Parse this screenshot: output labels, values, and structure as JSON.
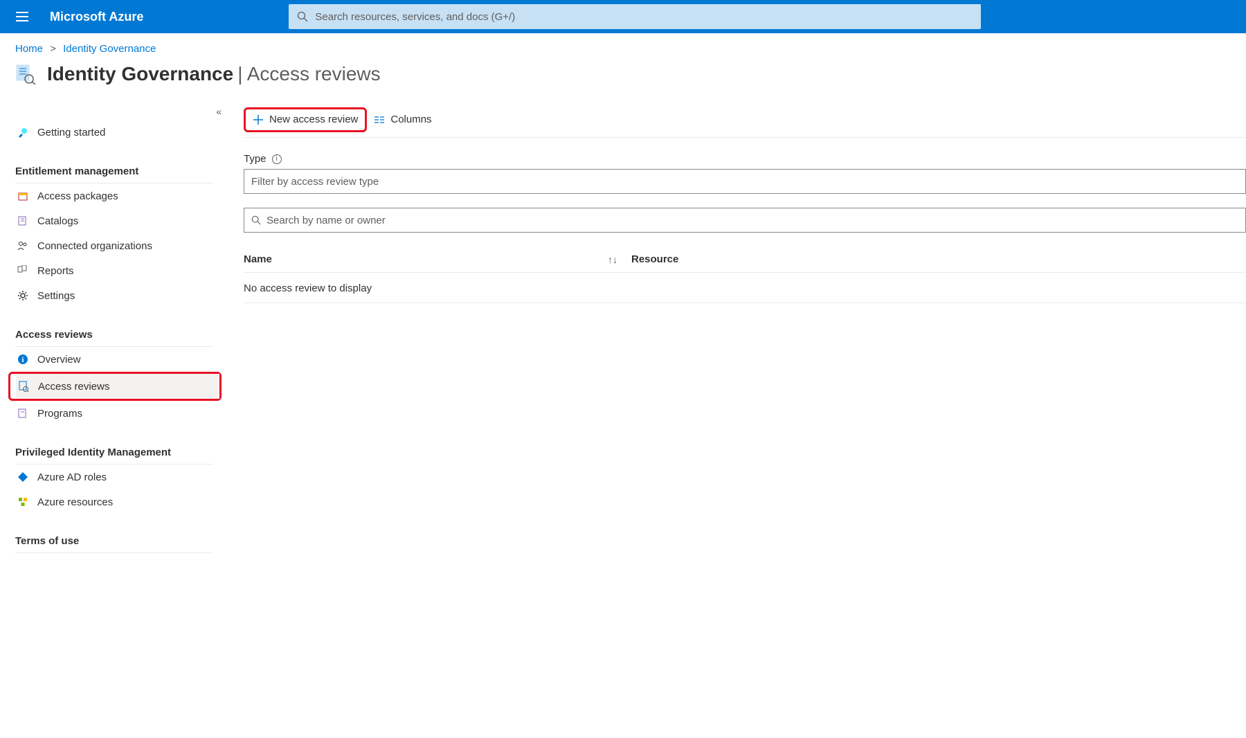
{
  "header": {
    "brand": "Microsoft Azure",
    "search_placeholder": "Search resources, services, and docs (G+/)"
  },
  "breadcrumb": {
    "items": [
      "Home",
      "Identity Governance"
    ],
    "sep": ">"
  },
  "page_title": {
    "main": "Identity Governance",
    "sub": "| Access reviews"
  },
  "sidebar": {
    "getting_started": "Getting started",
    "sections": [
      {
        "header": "Entitlement management",
        "items": [
          {
            "label": "Access packages"
          },
          {
            "label": "Catalogs"
          },
          {
            "label": "Connected organizations"
          },
          {
            "label": "Reports"
          },
          {
            "label": "Settings"
          }
        ]
      },
      {
        "header": "Access reviews",
        "items": [
          {
            "label": "Overview"
          },
          {
            "label": "Access reviews"
          },
          {
            "label": "Programs"
          }
        ]
      },
      {
        "header": "Privileged Identity Management",
        "items": [
          {
            "label": "Azure AD roles"
          },
          {
            "label": "Azure resources"
          }
        ]
      },
      {
        "header": "Terms of use",
        "items": []
      }
    ]
  },
  "toolbar": {
    "new_review": "New access review",
    "columns": "Columns"
  },
  "filters": {
    "type_label": "Type",
    "type_placeholder": "Filter by access review type",
    "search_placeholder": "Search by name or owner"
  },
  "table": {
    "col_name": "Name",
    "col_resource": "Resource",
    "empty": "No access review to display"
  }
}
